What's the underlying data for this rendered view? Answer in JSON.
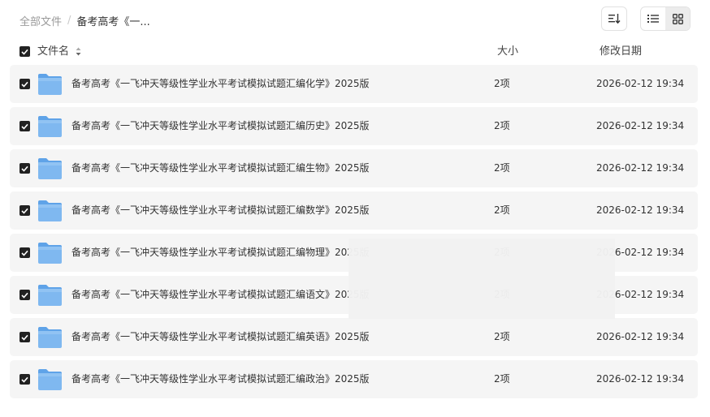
{
  "breadcrumb": {
    "root": "全部文件",
    "separator": "/",
    "current": "备考高考《一..."
  },
  "table": {
    "headers": {
      "name": "文件名",
      "size": "大小",
      "modified": "修改日期"
    },
    "rows": [
      {
        "name": "备考高考《一飞冲天等级性学业水平考试模拟试题汇编化学》2025版",
        "size": "2项",
        "modified": "2026-02-12 19:34"
      },
      {
        "name": "备考高考《一飞冲天等级性学业水平考试模拟试题汇编历史》2025版",
        "size": "2项",
        "modified": "2026-02-12 19:34"
      },
      {
        "name": "备考高考《一飞冲天等级性学业水平考试模拟试题汇编生物》2025版",
        "size": "2项",
        "modified": "2026-02-12 19:34"
      },
      {
        "name": "备考高考《一飞冲天等级性学业水平考试模拟试题汇编数学》2025版",
        "size": "2项",
        "modified": "2026-02-12 19:34"
      },
      {
        "name": "备考高考《一飞冲天等级性学业水平考试模拟试题汇编物理》2025版",
        "size": "2项",
        "modified": "2026-02-12 19:34"
      },
      {
        "name": "备考高考《一飞冲天等级性学业水平考试模拟试题汇编语文》2025版",
        "size": "2项",
        "modified": "2026-02-12 19:34"
      },
      {
        "name": "备考高考《一飞冲天等级性学业水平考试模拟试题汇编英语》2025版",
        "size": "2项",
        "modified": "2026-02-12 19:34"
      },
      {
        "name": "备考高考《一飞冲天等级性学业水平考试模拟试题汇编政治》2025版",
        "size": "2项",
        "modified": "2026-02-12 19:34"
      }
    ]
  },
  "icons": {
    "folder": "folder-icon",
    "sort": "sort-icon",
    "list_view": "list-view-icon",
    "grid_view": "grid-view-icon",
    "check": "check-icon"
  },
  "colors": {
    "folder": "#7fb8f0",
    "row_bg": "#f5f5f5",
    "checkbox": "#222222"
  }
}
